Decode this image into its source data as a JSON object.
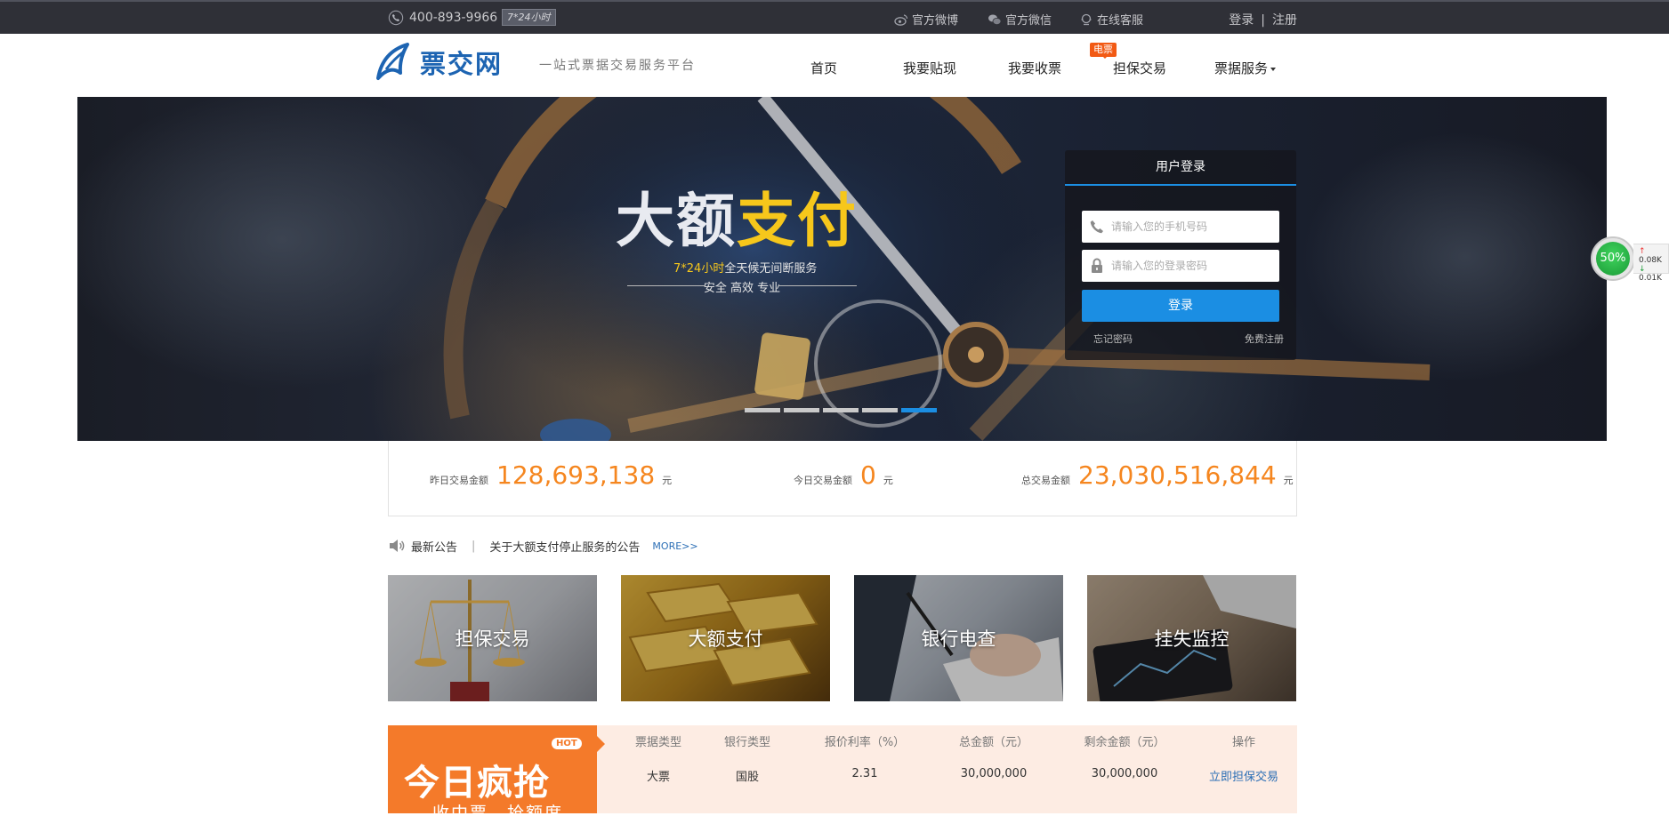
{
  "topbar": {
    "phone": "400-893-9966",
    "hours": "7*24小时",
    "links": [
      {
        "label": "官方微博",
        "icon": "weibo-icon"
      },
      {
        "label": "官方微信",
        "icon": "wechat-icon"
      },
      {
        "label": "在线客服",
        "icon": "support-icon"
      }
    ],
    "login": "登录",
    "separator": "|",
    "register": "注册"
  },
  "header": {
    "logo_text": "票交网",
    "slogan": "一站式票据交易服务平台",
    "nav": [
      {
        "label": "首页"
      },
      {
        "label": "我要贴现"
      },
      {
        "label": "我要收票"
      },
      {
        "label": "担保交易",
        "badge": "电票"
      },
      {
        "label": "票据服务"
      }
    ]
  },
  "banner": {
    "title_main": "大额",
    "title_highlight": "支付",
    "sub_highlight": "7*24小时",
    "sub_text": "全天候无间断服务",
    "tagline": "安全 高效 专业",
    "slide_count": 5,
    "active_slide": 5
  },
  "login": {
    "title": "用户登录",
    "phone_placeholder": "请输入您的手机号码",
    "password_placeholder": "请输入您的登录密码",
    "button": "登录",
    "forgot": "忘记密码",
    "register": "免费注册"
  },
  "stats": [
    {
      "label": "昨日交易金额",
      "value": "128,693,138",
      "unit": "元"
    },
    {
      "label": "今日交易金额",
      "value": "0",
      "unit": "元"
    },
    {
      "label": "总交易金额",
      "value": "23,030,516,844",
      "unit": "元"
    }
  ],
  "notice": {
    "label": "最新公告",
    "separator": "|",
    "text": "关于大额支付停止服务的公告",
    "more": "MORE>>"
  },
  "services": [
    {
      "label": "担保交易"
    },
    {
      "label": "大额支付"
    },
    {
      "label": "银行电查"
    },
    {
      "label": "挂失监控"
    }
  ],
  "hot": {
    "badge": "HOT",
    "title": "今日疯抢",
    "subtitle": "收中票、抢额度",
    "headers": [
      "票据类型",
      "银行类型",
      "报价利率（%）",
      "总金额（元）",
      "剩余金额（元）",
      "操作"
    ],
    "rows": [
      [
        "大票",
        "国股",
        "2.31",
        "30,000,000",
        "30,000,000",
        "立即担保交易"
      ]
    ]
  },
  "side_widget": {
    "percent": "50%",
    "up": "0.08K",
    "down": "0.01K"
  },
  "colors": {
    "topbar": "#2f3037",
    "brand_blue": "#1d64b2",
    "accent_blue": "#1b8ee3",
    "highlight_yellow": "#f6c71b",
    "stat_orange": "#f5861f",
    "hot_orange": "#f47a2a"
  }
}
